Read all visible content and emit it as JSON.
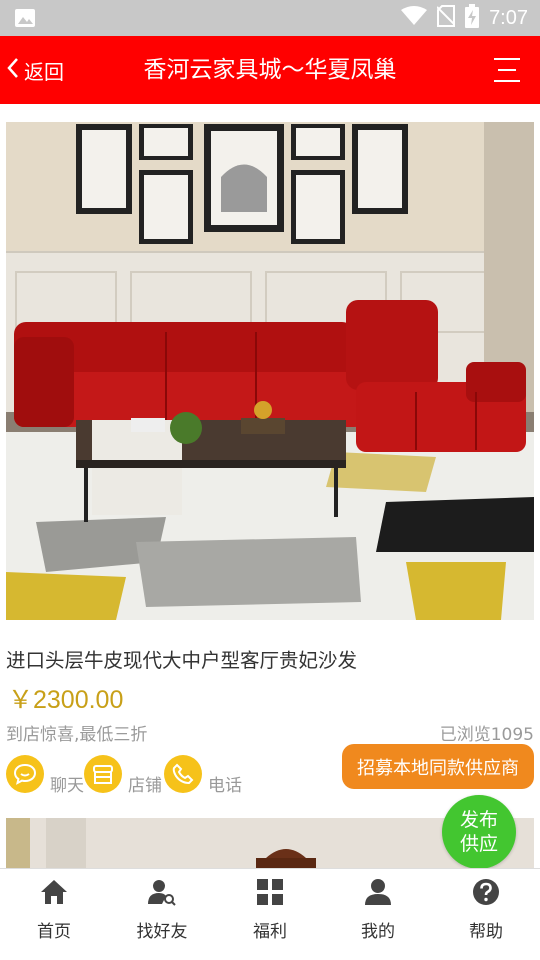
{
  "status_bar": {
    "time": "7:07",
    "icons": [
      "image-notification-icon",
      "wifi-icon",
      "no-sim-icon",
      "battery-charging-icon"
    ]
  },
  "header": {
    "back_label": "返回",
    "title": "香河云家具城～华夏凤巢",
    "background_color": "#ff0000"
  },
  "product": {
    "image_description_icon": "product-photo",
    "title": "进口头层牛皮现代大中户型客厅贵妃沙发",
    "price": "￥2300.00",
    "promo": "到店惊喜,最低三折",
    "views": "已浏览1095",
    "actions": [
      {
        "label": "聊天",
        "icon": "chat-icon"
      },
      {
        "label": "店铺",
        "icon": "store-icon"
      },
      {
        "label": "电话",
        "icon": "phone-icon"
      }
    ],
    "recruit_label": "招募本地同款供应商"
  },
  "publish_button": {
    "line1": "发布",
    "line2": "供应"
  },
  "bottom_nav": [
    {
      "label": "首页",
      "icon": "home-icon"
    },
    {
      "label": "找好友",
      "icon": "find-friend-icon"
    },
    {
      "label": "福利",
      "icon": "grid-icon"
    },
    {
      "label": "我的",
      "icon": "user-icon"
    },
    {
      "label": "帮助",
      "icon": "help-icon"
    }
  ],
  "colors": {
    "header": "#ff0000",
    "price": "#c8a018",
    "action_circle": "#f6c21a",
    "recruit_button": "#f0891e",
    "publish_button": "#43c630"
  }
}
